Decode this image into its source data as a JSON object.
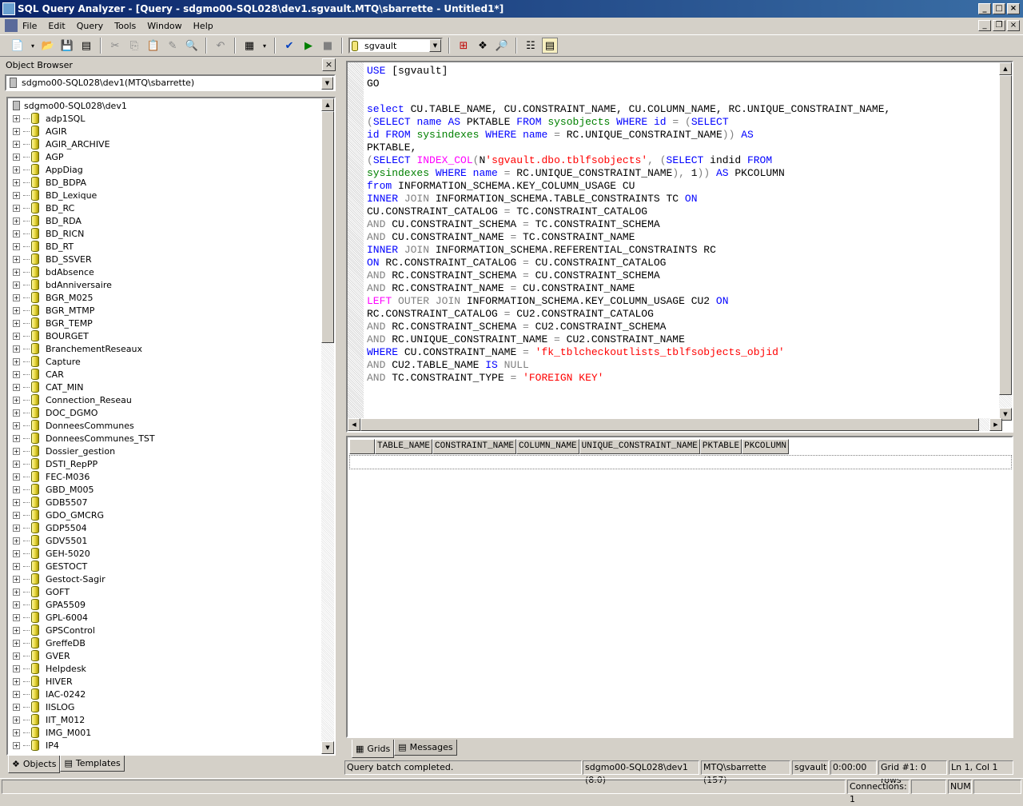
{
  "window": {
    "title": "SQL Query Analyzer - [Query - sdgmo00-SQL028\\dev1.sgvault.MTQ\\sbarrette - Untitled1*]"
  },
  "menu": [
    "File",
    "Edit",
    "Query",
    "Tools",
    "Window",
    "Help"
  ],
  "toolbar": {
    "database": "sgvault"
  },
  "object_browser": {
    "title": "Object Browser",
    "connection": "sdgmo00-SQL028\\dev1(MTQ\\sbarrette)",
    "root": "sdgmo00-SQL028\\dev1",
    "databases": [
      "adp1SQL",
      "AGIR",
      "AGIR_ARCHIVE",
      "AGP",
      "AppDiag",
      "BD_BDPA",
      "BD_Lexique",
      "BD_RC",
      "BD_RDA",
      "BD_RICN",
      "BD_RT",
      "BD_SSVER",
      "bdAbsence",
      "bdAnniversaire",
      "BGR_M025",
      "BGR_MTMP",
      "BGR_TEMP",
      "BOURGET",
      "BranchementReseaux",
      "Capture",
      "CAR",
      "CAT_MIN",
      "Connection_Reseau",
      "DOC_DGMO",
      "DonneesCommunes",
      "DonneesCommunes_TST",
      "Dossier_gestion",
      "DSTI_RepPP",
      "FEC-M036",
      "GBD_M005",
      "GDB5507",
      "GDO_GMCRG",
      "GDP5504",
      "GDV5501",
      "GEH-5020",
      "GESTOCT",
      "Gestoct-Sagir",
      "GOFT",
      "GPA5509",
      "GPL-6004",
      "GPSControl",
      "GreffeDB",
      "GVER",
      "Helpdesk",
      "HIVER",
      "IAC-0242",
      "IISLOG",
      "IIT_M012",
      "IMG_M001",
      "IP4"
    ],
    "tabs": [
      "Objects",
      "Templates"
    ]
  },
  "editor": {
    "lines": [
      [
        [
          "k",
          "USE"
        ],
        [
          "t",
          " [sgvault]"
        ]
      ],
      [
        [
          "t",
          "GO"
        ]
      ],
      [],
      [
        [
          "k",
          "select"
        ],
        [
          "t",
          " CU.TABLE_NAME, CU.CONSTRAINT_NAME, CU.COLUMN_NAME, RC.UNIQUE_CONSTRAINT_NAME,"
        ]
      ],
      [
        [
          "g",
          "("
        ],
        [
          "k",
          "SELECT"
        ],
        [
          "t",
          " "
        ],
        [
          "k",
          "name"
        ],
        [
          "t",
          " "
        ],
        [
          "k",
          "AS"
        ],
        [
          "t",
          " PKTABLE "
        ],
        [
          "k",
          "FROM"
        ],
        [
          "t",
          " "
        ],
        [
          "n",
          "sysobjects"
        ],
        [
          "t",
          " "
        ],
        [
          "k",
          "WHERE"
        ],
        [
          "t",
          " "
        ],
        [
          "k",
          "id"
        ],
        [
          "g",
          " = ("
        ],
        [
          "k",
          "SELECT"
        ]
      ],
      [
        [
          "k",
          "id"
        ],
        [
          "t",
          " "
        ],
        [
          "k",
          "FROM"
        ],
        [
          "t",
          " "
        ],
        [
          "n",
          "sysindexes"
        ],
        [
          "t",
          " "
        ],
        [
          "k",
          "WHERE"
        ],
        [
          "t",
          " "
        ],
        [
          "k",
          "name"
        ],
        [
          "g",
          " ="
        ],
        [
          "t",
          " RC.UNIQUE_CONSTRAINT_NAME"
        ],
        [
          "g",
          "))"
        ],
        [
          "t",
          " "
        ],
        [
          "k",
          "AS"
        ]
      ],
      [
        [
          "t",
          "PKTABLE,"
        ]
      ],
      [
        [
          "g",
          "("
        ],
        [
          "k",
          "SELECT"
        ],
        [
          "t",
          " "
        ],
        [
          "m",
          "INDEX_COL"
        ],
        [
          "g",
          "("
        ],
        [
          "t",
          "N"
        ],
        [
          "s",
          "'sgvault.dbo.tblfsobjects'"
        ],
        [
          "g",
          ", ("
        ],
        [
          "k",
          "SELECT"
        ],
        [
          "t",
          " indid "
        ],
        [
          "k",
          "FROM"
        ]
      ],
      [
        [
          "n",
          "sysindexes"
        ],
        [
          "t",
          " "
        ],
        [
          "k",
          "WHERE"
        ],
        [
          "t",
          " "
        ],
        [
          "k",
          "name"
        ],
        [
          "g",
          " ="
        ],
        [
          "t",
          " RC.UNIQUE_CONSTRAINT_NAME"
        ],
        [
          "g",
          "),"
        ],
        [
          "t",
          " 1"
        ],
        [
          "g",
          "))"
        ],
        [
          "t",
          " "
        ],
        [
          "k",
          "AS"
        ],
        [
          "t",
          " PKCOLUMN"
        ]
      ],
      [
        [
          "k",
          "from"
        ],
        [
          "t",
          " INFORMATION_SCHEMA.KEY_COLUMN_USAGE CU"
        ]
      ],
      [
        [
          "k",
          "INNER"
        ],
        [
          "t",
          " "
        ],
        [
          "g",
          "JOIN"
        ],
        [
          "t",
          " INFORMATION_SCHEMA.TABLE_CONSTRAINTS TC "
        ],
        [
          "k",
          "ON"
        ]
      ],
      [
        [
          "t",
          "CU.CONSTRAINT_CATALOG "
        ],
        [
          "g",
          "="
        ],
        [
          "t",
          " TC.CONSTRAINT_CATALOG"
        ]
      ],
      [
        [
          "g",
          "AND"
        ],
        [
          "t",
          " CU.CONSTRAINT_SCHEMA "
        ],
        [
          "g",
          "="
        ],
        [
          "t",
          " TC.CONSTRAINT_SCHEMA"
        ]
      ],
      [
        [
          "g",
          "AND"
        ],
        [
          "t",
          " CU.CONSTRAINT_NAME "
        ],
        [
          "g",
          "="
        ],
        [
          "t",
          " TC.CONSTRAINT_NAME"
        ]
      ],
      [
        [
          "k",
          "INNER"
        ],
        [
          "t",
          " "
        ],
        [
          "g",
          "JOIN"
        ],
        [
          "t",
          " INFORMATION_SCHEMA.REFERENTIAL_CONSTRAINTS RC"
        ]
      ],
      [
        [
          "k",
          "ON"
        ],
        [
          "t",
          " RC.CONSTRAINT_CATALOG "
        ],
        [
          "g",
          "="
        ],
        [
          "t",
          " CU.CONSTRAINT_CATALOG"
        ]
      ],
      [
        [
          "g",
          "AND"
        ],
        [
          "t",
          " RC.CONSTRAINT_SCHEMA "
        ],
        [
          "g",
          "="
        ],
        [
          "t",
          " CU.CONSTRAINT_SCHEMA"
        ]
      ],
      [
        [
          "g",
          "AND"
        ],
        [
          "t",
          " RC.CONSTRAINT_NAME "
        ],
        [
          "g",
          "="
        ],
        [
          "t",
          " CU.CONSTRAINT_NAME"
        ]
      ],
      [
        [
          "m",
          "LEFT"
        ],
        [
          "t",
          " "
        ],
        [
          "g",
          "OUTER JOIN"
        ],
        [
          "t",
          " INFORMATION_SCHEMA.KEY_COLUMN_USAGE CU2 "
        ],
        [
          "k",
          "ON"
        ]
      ],
      [
        [
          "t",
          "RC.CONSTRAINT_CATALOG "
        ],
        [
          "g",
          "="
        ],
        [
          "t",
          " CU2.CONSTRAINT_CATALOG"
        ]
      ],
      [
        [
          "g",
          "AND"
        ],
        [
          "t",
          " RC.CONSTRAINT_SCHEMA "
        ],
        [
          "g",
          "="
        ],
        [
          "t",
          " CU2.CONSTRAINT_SCHEMA"
        ]
      ],
      [
        [
          "g",
          "AND"
        ],
        [
          "t",
          " RC.UNIQUE_CONSTRAINT_NAME "
        ],
        [
          "g",
          "="
        ],
        [
          "t",
          " CU2.CONSTRAINT_NAME"
        ]
      ],
      [
        [
          "k",
          "WHERE"
        ],
        [
          "t",
          " CU.CONSTRAINT_NAME "
        ],
        [
          "g",
          "="
        ],
        [
          "t",
          " "
        ],
        [
          "s",
          "'fk_tblcheckoutlists_tblfsobjects_objid'"
        ]
      ],
      [
        [
          "g",
          "AND"
        ],
        [
          "t",
          " CU2.TABLE_NAME "
        ],
        [
          "k",
          "IS"
        ],
        [
          "t",
          " "
        ],
        [
          "g",
          "NULL"
        ]
      ],
      [
        [
          "g",
          "AND"
        ],
        [
          "t",
          " TC.CONSTRAINT_TYPE "
        ],
        [
          "g",
          "="
        ],
        [
          "t",
          " "
        ],
        [
          "s",
          "'FOREIGN KEY'"
        ]
      ]
    ]
  },
  "results": {
    "columns": [
      "TABLE_NAME",
      "CONSTRAINT_NAME",
      "COLUMN_NAME",
      "UNIQUE_CONSTRAINT_NAME",
      "PKTABLE",
      "PKCOLUMN"
    ],
    "tabs": [
      "Grids",
      "Messages"
    ]
  },
  "status": {
    "message": "Query batch completed.",
    "server": "sdgmo00-SQL028\\dev1 (8.0)",
    "user": "MTQ\\sbarrette (157)",
    "database": "sgvault",
    "elapsed": "0:00:00",
    "rows": "Grid #1: 0 rows",
    "position": "Ln 1, Col 1",
    "connections": "Connections: 1",
    "num": "NUM"
  }
}
